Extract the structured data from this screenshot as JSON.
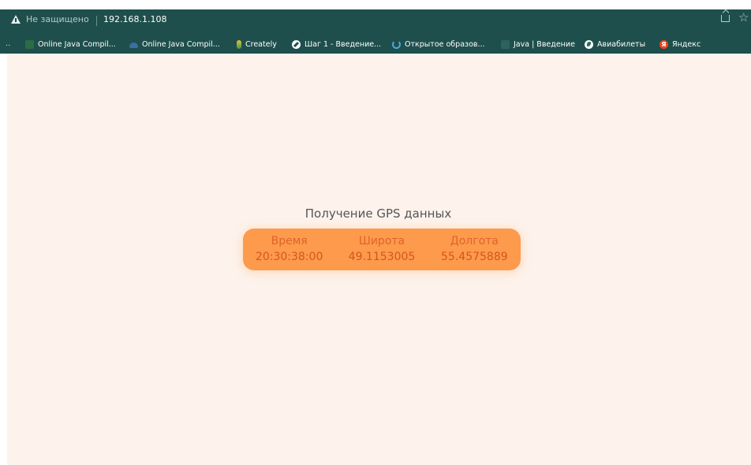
{
  "browser": {
    "security_label": "Не защищено",
    "url": "192.168.1.108",
    "bookmarks_overflow": "..",
    "bookmarks": [
      {
        "label": "Online Java Compil...",
        "icon": "java-icon"
      },
      {
        "label": "Online Java Compil...",
        "icon": "java-icon"
      },
      {
        "label": "Creately",
        "icon": "creately-icon"
      },
      {
        "label": "Шаг 1 - Введение...",
        "icon": "stepik-icon"
      },
      {
        "label": "Открытое образов...",
        "icon": "edu-icon"
      },
      {
        "label": "Java | Введение",
        "icon": "page-icon"
      },
      {
        "label": "Авиабилеты",
        "icon": "globe-icon"
      },
      {
        "label": "Яндекс",
        "icon": "yandex-icon"
      }
    ],
    "yandex_glyph": "Я",
    "star_glyph": "☆"
  },
  "page": {
    "title": "Получение GPS данных",
    "table": {
      "headers": [
        "Время",
        "Широта",
        "Долгота"
      ],
      "row": [
        "20:30:38:00",
        "49.1153005",
        "55.4575889"
      ]
    }
  },
  "colors": {
    "chrome": "#1e4f4d",
    "page_background": "#fdf3ec",
    "card": "#fd9a4c",
    "card_text": "#d4561e",
    "title_text": "#555555"
  }
}
